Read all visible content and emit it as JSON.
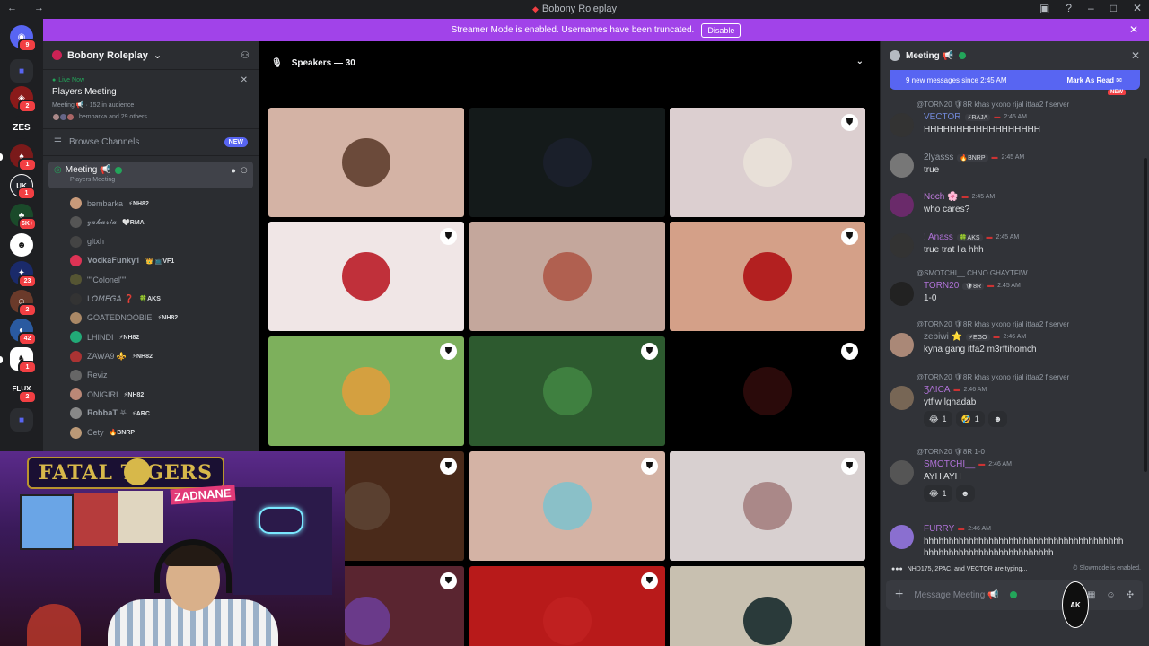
{
  "titlebar": {
    "title": "Bobony Roleplay",
    "nav": "← →"
  },
  "banner": {
    "text": "Streamer Mode is enabled. Usernames have been truncated.",
    "button": "Disable"
  },
  "servers": [
    {
      "label": "ZES",
      "color": "#1e1f22",
      "badge": ""
    },
    {
      "label": "UK",
      "color": "#23272e",
      "badge": ""
    },
    {
      "label": "FLUX",
      "color": "#1e1f22",
      "badge": "2"
    }
  ],
  "server_badges": [
    "9",
    "2",
    "1",
    "1",
    "6K+",
    "23",
    "2",
    "42",
    "1",
    "2"
  ],
  "guild": {
    "name": "Bobony Roleplay"
  },
  "event": {
    "live": "Live Now",
    "title": "Players Meeting",
    "meta": "Meeting 📢 · 152 in audience",
    "people": "bembarka and 29 others"
  },
  "browse": {
    "label": "Browse Channels",
    "badge": "NEW"
  },
  "voice_channel": {
    "name": "Meeting 📢",
    "sub": "Players Meeting"
  },
  "members": [
    {
      "name": "bembarka",
      "tag": "⚡NH82",
      "color": "#c89a7a"
    },
    {
      "name": "𝔃𝓪𝓴𝓪𝓻𝓲𝓪",
      "tag": "🤍RMA",
      "color": "#555"
    },
    {
      "name": "gltxh",
      "tag": "",
      "color": "#444"
    },
    {
      "name": "𝐕𝐨𝐝𝐤𝐚𝐅𝐮𝐧𝐤𝐲𝟏",
      "tag": "👑 📺VF1",
      "color": "#d35"
    },
    {
      "name": "\"\"Colonel\"\"",
      "tag": "",
      "color": "#553"
    },
    {
      "name": "I 𝘖𝘔𝘌𝘎𝘈 ❓",
      "tag": "🍀AKS",
      "color": "#333"
    },
    {
      "name": "GOATEDNOOBIE",
      "tag": "⚡NH82",
      "color": "#a86"
    },
    {
      "name": "LHINDI",
      "tag": "⚡NH82",
      "color": "#2a7"
    },
    {
      "name": "ZAWA9 ⚜️",
      "tag": "⚡NH82",
      "color": "#a33"
    },
    {
      "name": "Reviz",
      "tag": "",
      "color": "#666"
    },
    {
      "name": "ONIGIRI",
      "tag": "⚡NH82",
      "color": "#b87"
    },
    {
      "name": "𝐑𝐨𝐛𝐛𝐚𝐓 ⛧",
      "tag": "⚡ARC",
      "color": "#888"
    },
    {
      "name": "Cety",
      "tag": "🔥BNRP",
      "color": "#b97"
    }
  ],
  "stage": {
    "speakers": "Speakers — 30"
  },
  "tiles": [
    {
      "bg": "#d4b3a5",
      "av": "#6b4a3a",
      "shield": false
    },
    {
      "bg": "#141a1a",
      "av": "#1a1f2a",
      "shield": false
    },
    {
      "bg": "#dccfd0",
      "av": "#e8e0d8",
      "shield": true
    },
    {
      "bg": "#f0e6e6",
      "av": "#c0303a",
      "shield": true
    },
    {
      "bg": "#c4a79c",
      "av": "#b06050",
      "shield": false
    },
    {
      "bg": "#d4a088",
      "av": "#b32020",
      "shield": true
    },
    {
      "bg": "#7db05c",
      "av": "#d4a040",
      "shield": true
    },
    {
      "bg": "#2d5a2f",
      "av": "#3f8040",
      "shield": true
    },
    {
      "bg": "#000000",
      "av": "#2a0a0a",
      "shield": true
    },
    {
      "bg": "#4a2a1a",
      "av": "#5a4030",
      "shield": true
    },
    {
      "bg": "#d4b3a5",
      "av": "#8ac0c8",
      "shield": true
    },
    {
      "bg": "#d8d0d0",
      "av": "#aa8888",
      "shield": true
    },
    {
      "bg": "#5a2530",
      "av": "#6a3a8a",
      "shield": true
    },
    {
      "bg": "#b81a1a",
      "av": "#c02020",
      "shield": true
    },
    {
      "bg": "#c8c0b0",
      "av": "#2a3a3a",
      "shield": false
    }
  ],
  "chat": {
    "title": "Meeting 📢",
    "newbar": "9 new messages since 2:45 AM",
    "mark_read": "Mark As Read",
    "new_label": "NEW",
    "messages": [
      {
        "reply": "@TORN20 🛡8R khas ykono rijal itfaa2 f server",
        "name": "VECTOR",
        "name_color": "#7289da",
        "role": "⚡RAJA",
        "time": "2:45 AM",
        "body": "HHHHHHHHHHHHHHHHHH",
        "av": "#333"
      },
      {
        "reply": "",
        "name": "2lyasss",
        "name_color": "#949ba4",
        "role": "🔥BNRP",
        "time": "2:45 AM",
        "body": "true",
        "av": "#777"
      },
      {
        "reply": "",
        "name": "Noch 🌸",
        "name_color": "#c27ce0",
        "role": "",
        "time": "2:45 AM",
        "body": "who cares?",
        "av": "#6a2a6a"
      },
      {
        "reply": "",
        "name": "! Anass",
        "name_color": "#b072d8",
        "role": "🍀AKS",
        "time": "2:45 AM",
        "body": "true trat lia hhh",
        "av": "#333"
      },
      {
        "reply": "@SMOTCHI__ CHNO GHAYTFIW",
        "name": "TORN20",
        "name_color": "#b072d8",
        "role": "🛡8R",
        "time": "2:45 AM",
        "body": "1-0",
        "av": "#222"
      },
      {
        "reply": "@TORN20 🛡8R khas ykono rijal itfaa2 f server",
        "name": "zebiwi ⭐",
        "name_color": "#949ba4",
        "role": "⚡EGO",
        "time": "2:46 AM",
        "body": "kyna gang itfa2 m3rftihomch",
        "av": "#a87"
      },
      {
        "reply": "@TORN20 🛡8R khas ykono rijal itfaa2 f server",
        "name": "ƷΛICA",
        "name_color": "#b072d8",
        "role": "",
        "time": "2:46 AM",
        "body": "ytfiw lghadab",
        "av": "#765"
      },
      {
        "reply": "@TORN20 🛡8R 1-0",
        "name": "SMOTCHI__",
        "name_color": "#b072d8",
        "role": "",
        "time": "2:46 AM",
        "body": "AYH AYH",
        "av": "#555"
      },
      {
        "reply": "",
        "name": "FURRY",
        "name_color": "#b072d8",
        "role": "",
        "time": "2:46 AM",
        "body": "hhhhhhhhhhhhhhhhhhhhhhhhhhhhhhhhhhhhhhhh",
        "body2": "hhhhhhhhhhhhhhhhhhhhhhhhhh",
        "av": "#8a6fd0"
      }
    ],
    "reactions": [
      [
        {
          "emoji": "😂",
          "count": "1"
        },
        {
          "emoji": "🤣",
          "count": "1"
        },
        {
          "emoji": "☻",
          "count": ""
        }
      ],
      [
        {
          "emoji": "😂",
          "count": "1"
        },
        {
          "emoji": "☻",
          "count": ""
        }
      ]
    ],
    "typing": "NHD175, 2PAC, and VECTOR are typing...",
    "slowmode": "Slowmode is enabled.",
    "composer_placeholder": "Message Meeting 📢"
  },
  "webcam": {
    "logo": "FATAL TIGERS",
    "caption": "ZADNANE"
  },
  "watermark": "AK"
}
